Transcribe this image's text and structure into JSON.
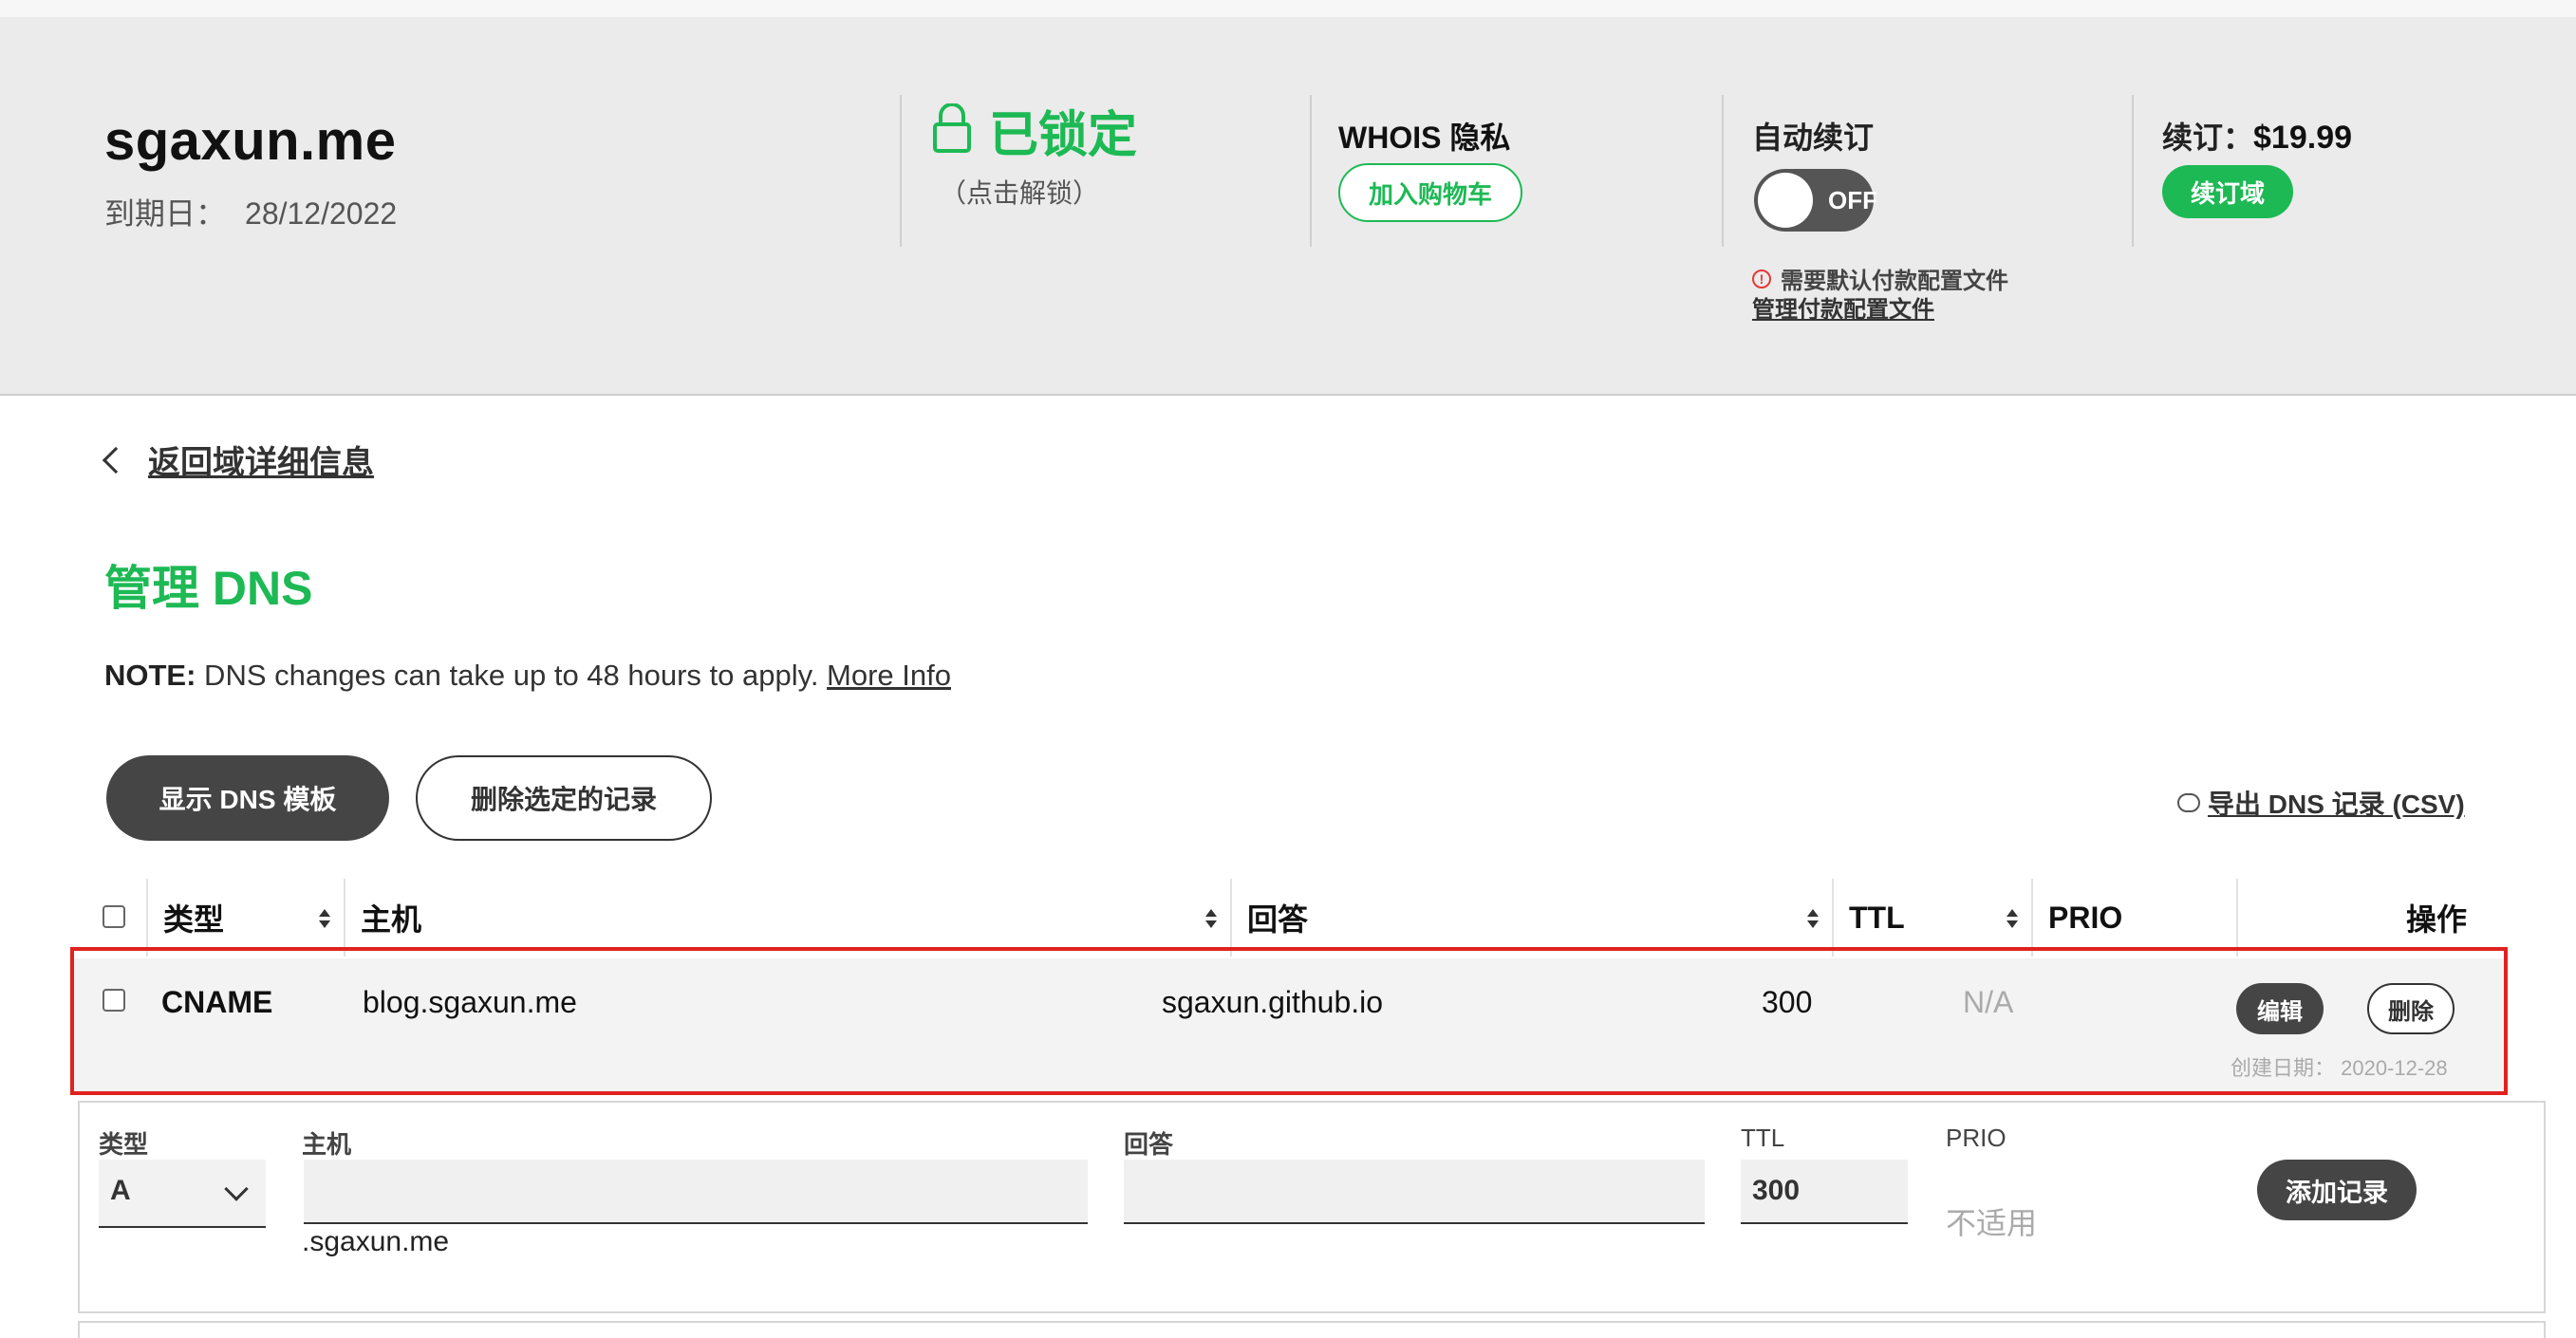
{
  "header": {
    "domain": "sgaxun.me",
    "expiry_label": "到期日：",
    "expiry_value": "28/12/2022",
    "lock_status": "已锁定",
    "lock_hint": "（点击解锁）",
    "whois_title": "WHOIS 隐私",
    "add_to_cart": "加入购物车",
    "auto_renew_title": "自动续订",
    "toggle_label": "OFF",
    "warning_text": "需要默认付款配置文件",
    "manage_payment": "管理付款配置文件",
    "renew_label": "续订：",
    "renew_price": "$19.99",
    "renew_button": "续订域"
  },
  "back_link": "返回域详细信息",
  "page_title": "管理 DNS",
  "note": {
    "label": "NOTE:",
    "text": " DNS changes can take up to 48 hours to apply. ",
    "link": "More Info"
  },
  "actions": {
    "show_templates": "显示 DNS 模板",
    "delete_selected": "删除选定的记录",
    "export": "导出 DNS 记录 (CSV)"
  },
  "table": {
    "columns": [
      "类型",
      "主机",
      "回答",
      "TTL",
      "PRIO",
      "操作"
    ],
    "rows": [
      {
        "type": "CNAME",
        "host": "blog.sgaxun.me",
        "answer": "sgaxun.github.io",
        "ttl": "300",
        "prio": "N/A",
        "edit": "编辑",
        "delete": "删除",
        "created": "创建日期：  2020-12-28"
      }
    ]
  },
  "add_form": {
    "type_label": "类型",
    "type_value": "A",
    "host_label": "主机",
    "host_value": "",
    "host_suffix": ".sgaxun.me",
    "answer_label": "回答",
    "answer_value": "",
    "ttl_label": "TTL",
    "ttl_value": "300",
    "prio_label": "PRIO",
    "prio_value": "不适用",
    "add_button": "添加记录"
  },
  "colors": {
    "accent_green": "#1db954",
    "dark_button": "#454545",
    "highlight_red": "#e0221f"
  }
}
